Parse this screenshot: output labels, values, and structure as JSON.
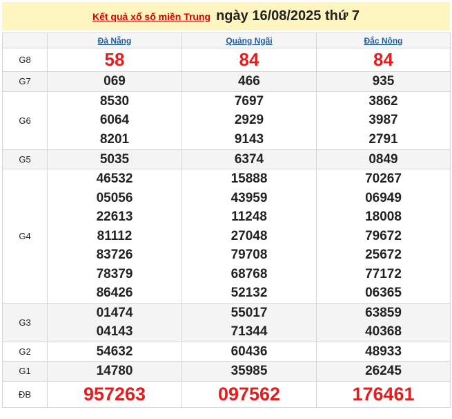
{
  "header": {
    "link_text": "Kết quả xổ số miền Trung",
    "title": "ngày 16/08/2025 thứ 7"
  },
  "provinces": [
    "Đà Nẵng",
    "Quảng Ngãi",
    "Đắc Nông"
  ],
  "prizes": {
    "g8": {
      "label": "G8",
      "cols": [
        [
          "58"
        ],
        [
          "84"
        ],
        [
          "84"
        ]
      ]
    },
    "g7": {
      "label": "G7",
      "cols": [
        [
          "069"
        ],
        [
          "466"
        ],
        [
          "935"
        ]
      ]
    },
    "g6": {
      "label": "G6",
      "cols": [
        [
          "8530",
          "6064",
          "8201"
        ],
        [
          "7697",
          "2929",
          "9143"
        ],
        [
          "3862",
          "3987",
          "2791"
        ]
      ]
    },
    "g5": {
      "label": "G5",
      "cols": [
        [
          "5035"
        ],
        [
          "6374"
        ],
        [
          "0849"
        ]
      ]
    },
    "g4": {
      "label": "G4",
      "cols": [
        [
          "46532",
          "05056",
          "22613",
          "81112",
          "83726",
          "78379",
          "86426"
        ],
        [
          "15888",
          "43959",
          "11248",
          "27048",
          "79708",
          "68768",
          "52132"
        ],
        [
          "70267",
          "06949",
          "18008",
          "79672",
          "25672",
          "77172",
          "06365"
        ]
      ]
    },
    "g3": {
      "label": "G3",
      "cols": [
        [
          "01474",
          "04143"
        ],
        [
          "55017",
          "71344"
        ],
        [
          "63859",
          "40368"
        ]
      ]
    },
    "g2": {
      "label": "G2",
      "cols": [
        [
          "54632"
        ],
        [
          "60436"
        ],
        [
          "48933"
        ]
      ]
    },
    "g1": {
      "label": "G1",
      "cols": [
        [
          "14780"
        ],
        [
          "35985"
        ],
        [
          "26245"
        ]
      ]
    },
    "db": {
      "label": "ĐB",
      "cols": [
        [
          "957263"
        ],
        [
          "097562"
        ],
        [
          "176461"
        ]
      ]
    }
  },
  "colors": {
    "accent_red": "#e41e1e",
    "header_bg": "#fff5be",
    "link_blue": "#1f5fa8"
  }
}
